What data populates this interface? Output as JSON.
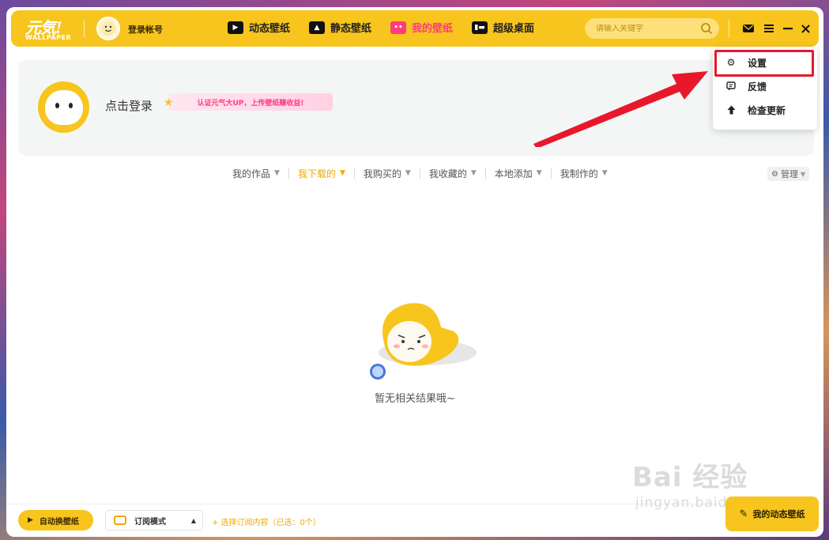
{
  "app": {
    "logo_main": "元気!",
    "logo_sub": "WALLPAPER"
  },
  "header": {
    "login_account": "登录帐号",
    "nav": [
      {
        "label": "动态壁纸",
        "icon": "video-icon",
        "active": false
      },
      {
        "label": "静态壁纸",
        "icon": "image-icon",
        "active": false
      },
      {
        "label": "我的壁纸",
        "icon": "my-wallpaper-icon",
        "active": true
      },
      {
        "label": "超级桌面",
        "icon": "desktop-icon",
        "active": false
      }
    ],
    "search_placeholder": "请输入关键字",
    "accent_color": "#f7c51d"
  },
  "profile": {
    "login_prompt": "点击登录",
    "promo_text": "认证元气大UP，上传壁纸赚收益!"
  },
  "menu": {
    "items": [
      {
        "label": "设置",
        "icon": "gear-icon"
      },
      {
        "label": "反馈",
        "icon": "feedback-icon"
      },
      {
        "label": "检查更新",
        "icon": "arrow-up-icon"
      }
    ],
    "highlight_color": "#e8182b"
  },
  "filters": {
    "tabs": [
      {
        "label": "我的作品",
        "active": false
      },
      {
        "label": "我下载的",
        "active": true
      },
      {
        "label": "我购买的",
        "active": false
      },
      {
        "label": "我收藏的",
        "active": false
      },
      {
        "label": "本地添加",
        "active": false
      },
      {
        "label": "我制作的",
        "active": false
      }
    ],
    "manage_label": "管理"
  },
  "empty_state": {
    "text": "暂无相关结果哦~"
  },
  "bottom": {
    "auto_switch_label": "自动换壁纸",
    "subscribe_mode_label": "订阅模式",
    "select_subscription": "+ 选择订阅内容（已选：0个）",
    "make_button_label": "我的动态壁纸"
  },
  "watermark": {
    "main": "Bai 经验",
    "sub": "jingyan.baidu.com"
  }
}
